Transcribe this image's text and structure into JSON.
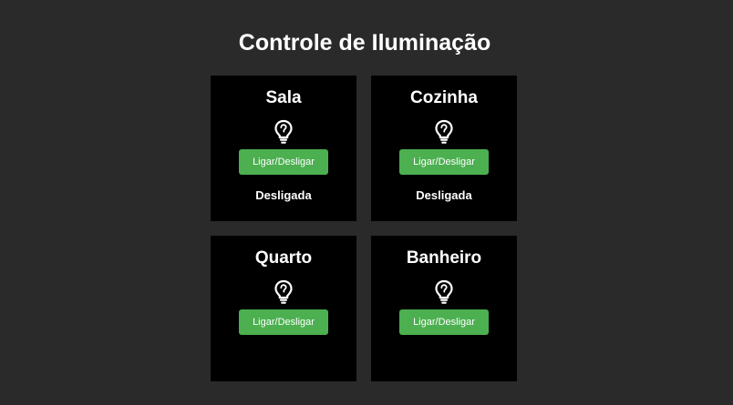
{
  "page": {
    "title": "Controle de Iluminação"
  },
  "colors": {
    "background": "#2b2a2a",
    "card": "#000000",
    "button": "#4caf50",
    "text": "#ffffff"
  },
  "rooms": [
    {
      "name": "Sala",
      "button_label": "Ligar/Desligar",
      "status": "Desligada",
      "icon": "lightbulb-icon"
    },
    {
      "name": "Cozinha",
      "button_label": "Ligar/Desligar",
      "status": "Desligada",
      "icon": "lightbulb-icon"
    },
    {
      "name": "Quarto",
      "button_label": "Ligar/Desligar",
      "status": "",
      "icon": "lightbulb-icon"
    },
    {
      "name": "Banheiro",
      "button_label": "Ligar/Desligar",
      "status": "",
      "icon": "lightbulb-icon"
    }
  ]
}
